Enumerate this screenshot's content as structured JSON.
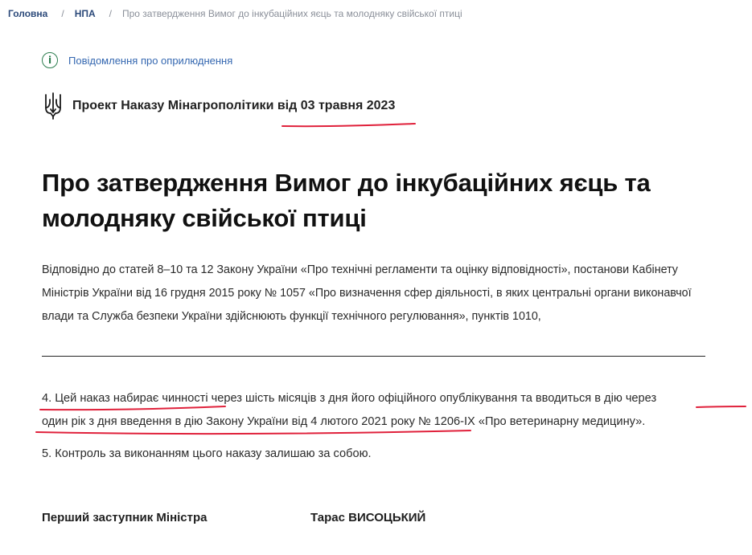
{
  "breadcrumb": {
    "home": "Головна",
    "section": "НПА",
    "current": "Про затвердження Вимог до інкубаційних яєць та молодняку свійської птиці",
    "separator": "/"
  },
  "notice": {
    "icon": "info-icon",
    "label": "Повідомлення про оприлюднення"
  },
  "project": {
    "icon": "trident-icon",
    "label": "Проект Наказу Мінагрополітики від 03 травня 2023"
  },
  "document": {
    "title_line1": "Про затвердження Вимог до інкубаційних яєць та",
    "title_line2": "молодняку свійської птиці",
    "preamble": "Відповідно до статей 8–10 та 12 Закону України «Про технічні регламенти та оцінку відповідності», постанови Кабінету Міністрів України від 16 грудня 2015 року № 1057 «Про визначення сфер діяльності, в яких центральні органи виконавчої влади та Служба безпеки України здійснюють функції технічного регулювання», пунктів 1010,",
    "item4_line1": "4. Цей наказ набирає чинності через шість місяців з дня його офіційного опублікування та вводиться в дію через",
    "item4_line2": "один рік з дня введення в дію Закону України від 4 лютого 2021 року № 1206-IX «Про ветеринарну медицину».",
    "item5": "5. Контроль за виконанням цього наказу залишаю за собою."
  },
  "signature": {
    "role": "Перший заступник Міністра",
    "name": "Тарас ВИСОЦЬКИЙ"
  },
  "colors": {
    "accent_link": "#3467b0",
    "breadcrumb_link": "#2c4a7a",
    "info_icon": "#2d7d4f",
    "annotation_red": "#e0213b"
  }
}
